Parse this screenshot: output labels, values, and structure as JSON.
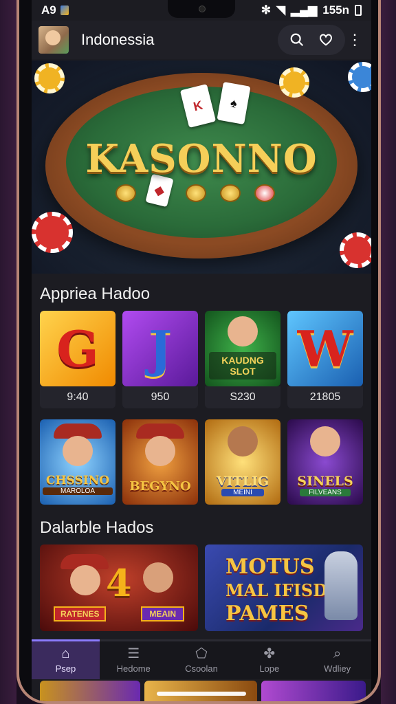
{
  "status_bar": {
    "left_text": "A9",
    "time": "155n"
  },
  "app_bar": {
    "title": "Indonessia"
  },
  "hero": {
    "title": "KASONNO",
    "card_glyphs": [
      "K",
      "♠",
      "◆"
    ]
  },
  "section1": {
    "title": "Appriea Hadoo",
    "games": [
      {
        "art": "G",
        "count": "9:40",
        "bg": "#f5b21a"
      },
      {
        "art": "J",
        "count": "950",
        "bg": "#8a2bd6"
      },
      {
        "art": "KAUDNG SLOT",
        "count": "S230",
        "bg": "#2a8a3a"
      },
      {
        "art": "W",
        "count": "21805",
        "bg": "#2a8fd6"
      }
    ],
    "games_row2": [
      {
        "art": "CHSSINO",
        "sub": "MAROLOA",
        "bg": "#2b7fd0"
      },
      {
        "art": "BEGYNO",
        "bg": "#d0681f"
      },
      {
        "art": "VITLIG",
        "sub": "MEINI",
        "bg": "#d79b1f"
      },
      {
        "art": "SINELS",
        "sub": "FILVEANS",
        "bg": "#6a2a8f"
      }
    ]
  },
  "section2": {
    "title": "Dalarble Hados",
    "features": [
      {
        "left_badge": "RATENES",
        "right_badge": "MEAIN",
        "num": "4"
      },
      {
        "headline": [
          "MOTUS",
          "MAL IFISD",
          "PAMES"
        ]
      }
    ]
  },
  "tabs": [
    {
      "icon": "home-icon",
      "glyph": "⌂",
      "label": "Psep",
      "active": true
    },
    {
      "icon": "list-icon",
      "glyph": "☰",
      "label": "Hedome",
      "active": false
    },
    {
      "icon": "tag-icon",
      "glyph": "⬠",
      "label": "Csoolan",
      "active": false
    },
    {
      "icon": "clover-icon",
      "glyph": "✤",
      "label": "Lope",
      "active": false
    },
    {
      "icon": "search-icon",
      "glyph": "⌕",
      "label": "Wdliey",
      "active": false
    }
  ]
}
